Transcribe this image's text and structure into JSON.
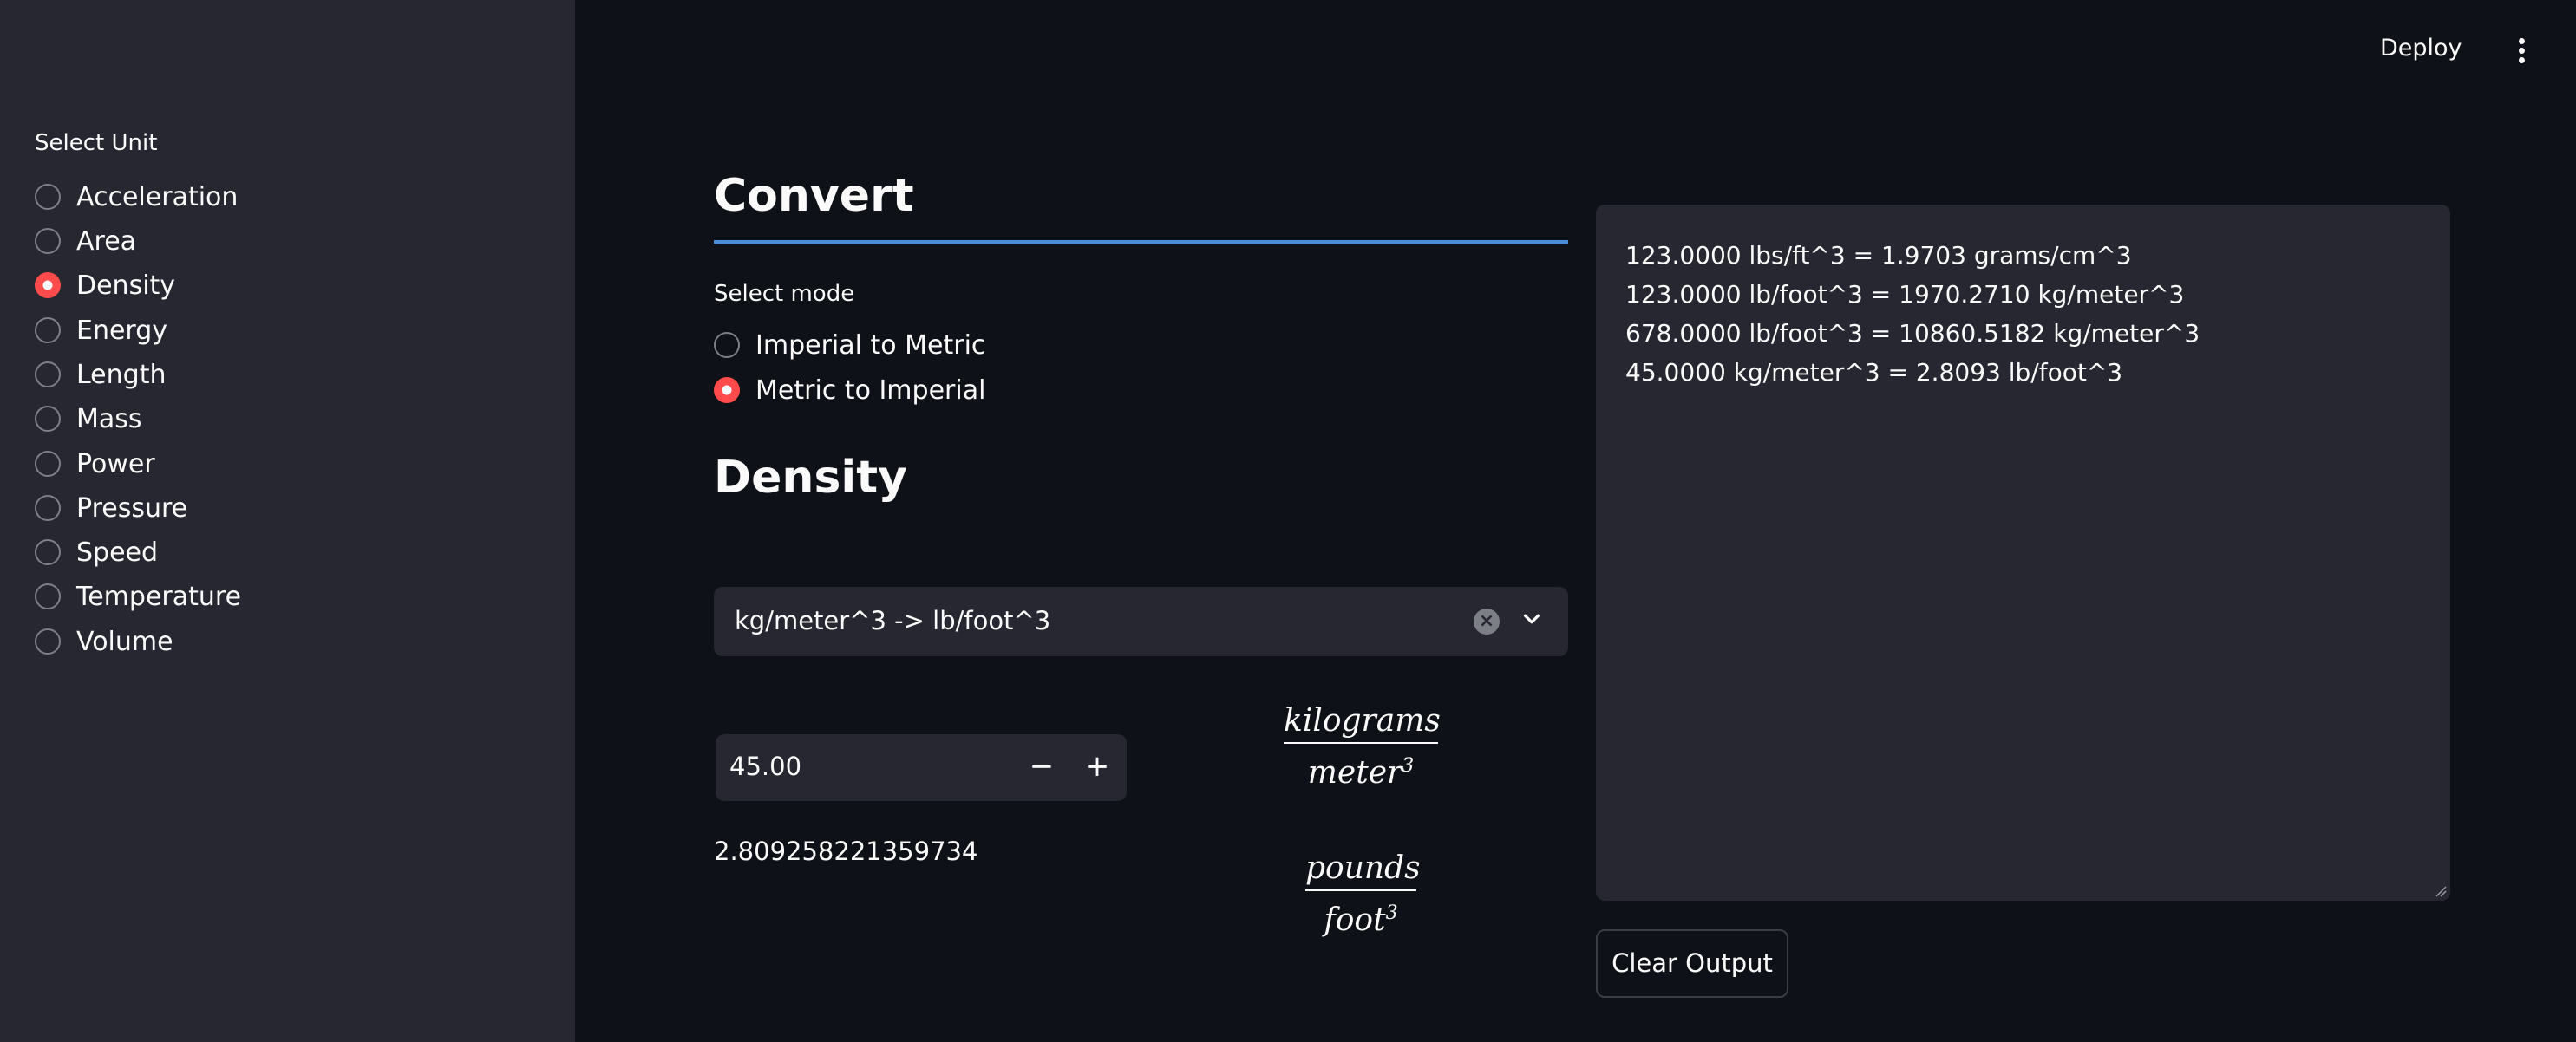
{
  "header": {
    "deploy_label": "Deploy",
    "menu_icon": "kebab-menu-icon"
  },
  "sidebar": {
    "label": "Select Unit",
    "selected": "Density",
    "options": [
      "Acceleration",
      "Area",
      "Density",
      "Energy",
      "Length",
      "Mass",
      "Power",
      "Pressure",
      "Speed",
      "Temperature",
      "Volume"
    ]
  },
  "main": {
    "title": "Convert",
    "mode_label": "Select mode",
    "mode_options": [
      "Imperial to Metric",
      "Metric to Imperial"
    ],
    "mode_selected": "Metric to Imperial",
    "section_title": "Density",
    "conversion_select": {
      "value": "kg/meter^3 -> lb/foot^3",
      "clear_icon": "clear-x-icon",
      "dropdown_icon": "chevron-down-icon"
    },
    "number_input": {
      "value": "45.00",
      "decrement_label": "−",
      "increment_label": "+"
    },
    "result": "2.809258221359734",
    "from_unit": {
      "numerator": "kilograms",
      "denominator": "meter",
      "exponent": "3"
    },
    "to_unit": {
      "numerator": "pounds",
      "denominator": "foot",
      "exponent": "3"
    }
  },
  "output": {
    "lines": [
      "123.0000 lbs/ft^3 = 1.9703 grams/cm^3",
      "123.0000 lb/foot^3 = 1970.2710 kg/meter^3",
      "678.0000 lb/foot^3 = 10860.5182 kg/meter^3",
      "45.0000 kg/meter^3 = 2.8093 lb/foot^3"
    ],
    "clear_button_label": "Clear Output"
  },
  "colors": {
    "background": "#0e1117",
    "sidebar": "#262730",
    "accent": "#ff4b4b",
    "divider": "#4a8bdc",
    "text": "#fafafa"
  }
}
